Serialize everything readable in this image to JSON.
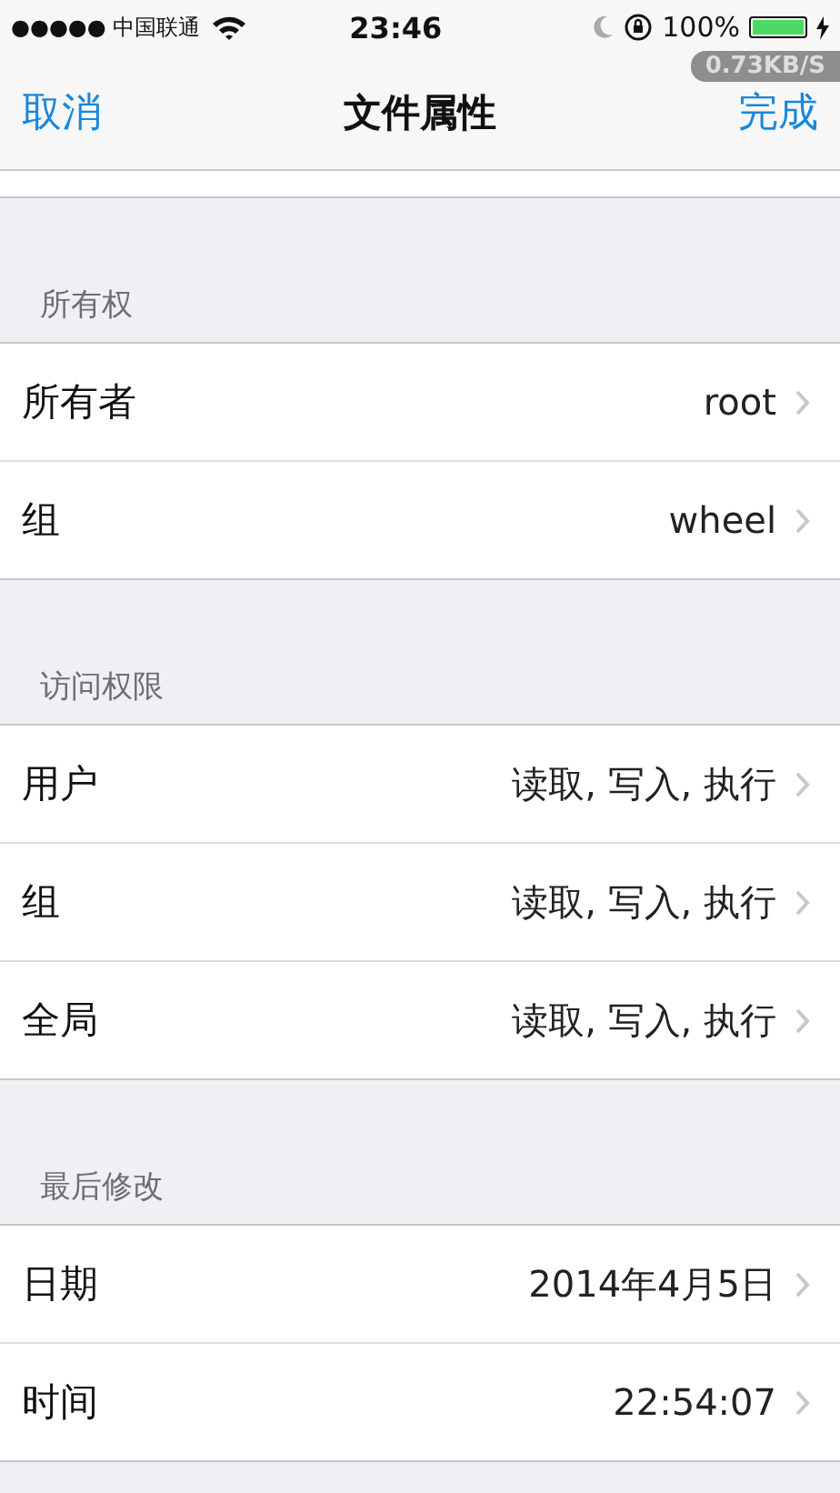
{
  "status_bar": {
    "carrier": "●●●●● 中国联通",
    "time": "23:46",
    "battery_percent": "100%",
    "network_speed": "0.73KB/S"
  },
  "nav_bar": {
    "left_button": "取消",
    "title": "文件属性",
    "right_button": "完成"
  },
  "sections": [
    {
      "header": "所有权",
      "rows": [
        {
          "label": "所有者",
          "value": "root"
        },
        {
          "label": "组",
          "value": "wheel"
        }
      ]
    },
    {
      "header": "访问权限",
      "rows": [
        {
          "label": "用户",
          "value": "读取, 写入, 执行"
        },
        {
          "label": "组",
          "value": "读取, 写入, 执行"
        },
        {
          "label": "全局",
          "value": "读取, 写入, 执行"
        }
      ]
    },
    {
      "header": "最后修改",
      "rows": [
        {
          "label": "日期",
          "value": "2014年4月5日"
        },
        {
          "label": "时间",
          "value": "22:54:07"
        }
      ]
    }
  ]
}
